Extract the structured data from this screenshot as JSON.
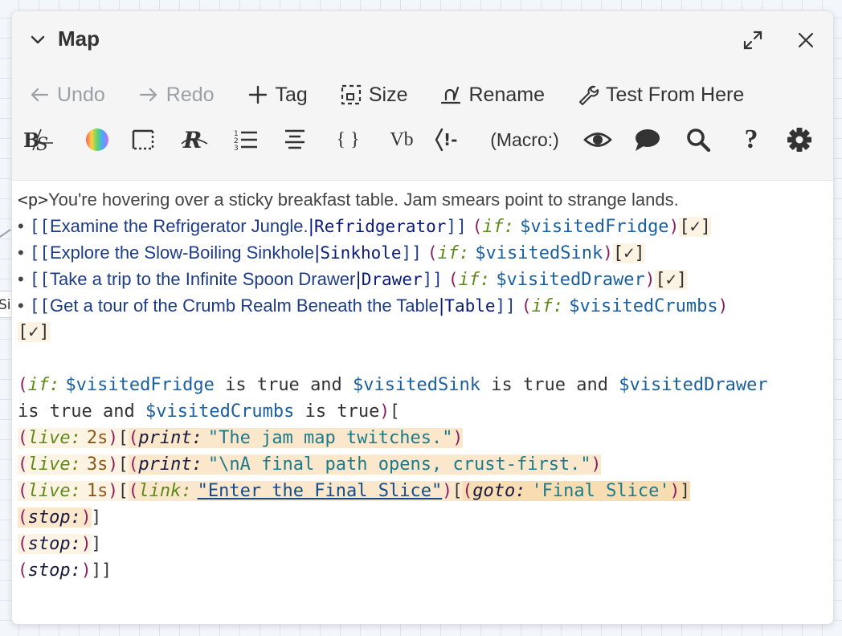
{
  "background": {
    "stub_text": "Si"
  },
  "dialog": {
    "title": "Map"
  },
  "toolbar": {
    "undo": "Undo",
    "redo": "Redo",
    "tag": "Tag",
    "size": "Size",
    "rename": "Rename",
    "test_from_here": "Test From Here"
  },
  "format_toolbar": {
    "macro_label": "(Macro:)",
    "vb_label": "Vb",
    "braces_label": "{ }",
    "help_label": "?"
  },
  "editor": {
    "line1": {
      "tag": "<p>",
      "text": "You're hovering over a sticky breakfast table. Jam smears point to strange lands."
    },
    "links": [
      {
        "bullet": "•",
        "text": "Examine the Refrigerator Jungle.",
        "target": "Refridgerator",
        "var": "$visitedFridge"
      },
      {
        "bullet": "•",
        "text": "Explore the Slow-Boiling Sinkhole",
        "target": "Sinkhole",
        "var": "$visitedSink"
      },
      {
        "bullet": "•",
        "text": "Take a trip to the Infinite Spoon Drawer",
        "target": "Drawer",
        "var": "$visitedDrawer"
      },
      {
        "bullet": "•",
        "text": "Get a tour of the Crumb Realm Beneath the Table",
        "target": "Table",
        "var": "$visitedCrumbs"
      }
    ],
    "open_link": "[[",
    "close_link": "]]",
    "bar": "|",
    "if_name": "if:",
    "check_hook": "[✓]",
    "paren_open": "(",
    "paren_close": ")",
    "cond": {
      "v1": "$visitedFridge",
      "is_true": " is true ",
      "and": "and ",
      "v2": "$visitedSink",
      "v3": "$visitedDrawer",
      "v4": "$visitedCrumbs",
      "line2_start": "is true and ",
      "line2_end": " is true",
      "hook_open": "["
    },
    "live_lines": [
      {
        "macro": "live:",
        "time": "2s",
        "inner_macro": "print:",
        "string": "\"The jam map twitches.\""
      },
      {
        "macro": "live:",
        "time": "3s",
        "inner_macro": "print:",
        "string": "\"\\nA final path opens, crust-first.\""
      }
    ],
    "live3": {
      "macro": "live:",
      "time": "1s",
      "link_macro": "link:",
      "link_string": "\"Enter the Final Slice\"",
      "goto_macro": "goto:",
      "goto_target": "'Final Slice'"
    },
    "stop": "stop:",
    "stop_lines": [
      "(stop:)]",
      "(stop:)]",
      "(stop:)]]"
    ]
  },
  "colors": {
    "accent_blue": "#1a5fa0",
    "macro_green": "#5e8a1a",
    "paren": "#8a1b5d",
    "string": "#1b7a8a"
  }
}
